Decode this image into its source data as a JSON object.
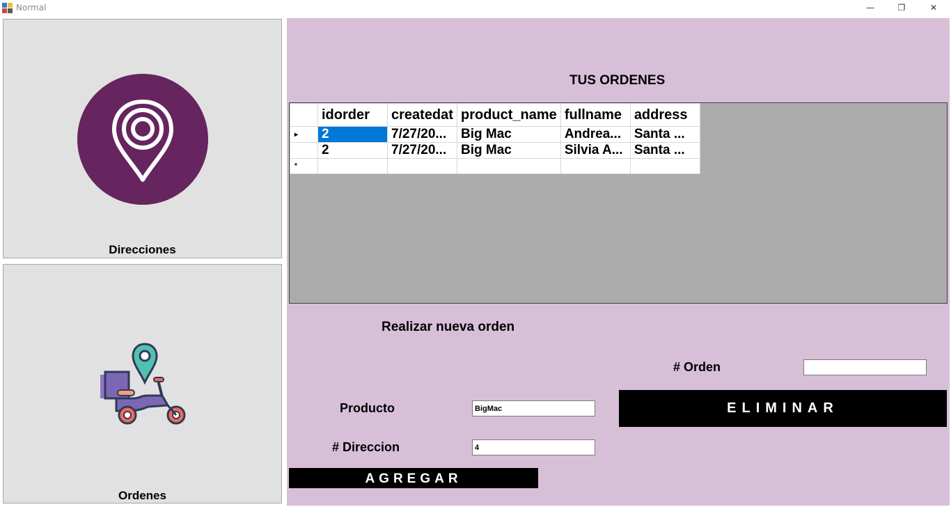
{
  "window": {
    "title": "Normal",
    "controls": {
      "minimize": "—",
      "restore": "❐",
      "close": "✕"
    }
  },
  "nav": {
    "direcciones_label": "Direcciones",
    "ordenes_label": "Ordenes",
    "direcciones_icon": "map-pin-icon",
    "ordenes_icon": "delivery-scooter-icon"
  },
  "main": {
    "title": "TUS ORDENES",
    "grid": {
      "columns": [
        "idorder",
        "createdat",
        "product_name",
        "fullname",
        "address"
      ],
      "rows": [
        [
          "2",
          "7/27/20...",
          "Big Mac",
          "Andrea...",
          "Santa ..."
        ],
        [
          "2",
          "7/27/20...",
          "Big Mac",
          "Silvia A...",
          "Santa ..."
        ]
      ],
      "current_row_marker": "▸",
      "new_row_marker": "*"
    },
    "new_order_title": "Realizar nueva orden",
    "orden_label": "# Orden",
    "orden_value": "",
    "producto_label": "Producto",
    "producto_value": "BigMac",
    "direccion_label": "#  Direccion",
    "direccion_value": "4",
    "eliminar_label": "ELIMINAR",
    "agregar_label": "AGREGAR"
  },
  "colors": {
    "main_bg": "#d8bfd8",
    "pin_circle": "#66255f",
    "selection": "#0078d7"
  }
}
